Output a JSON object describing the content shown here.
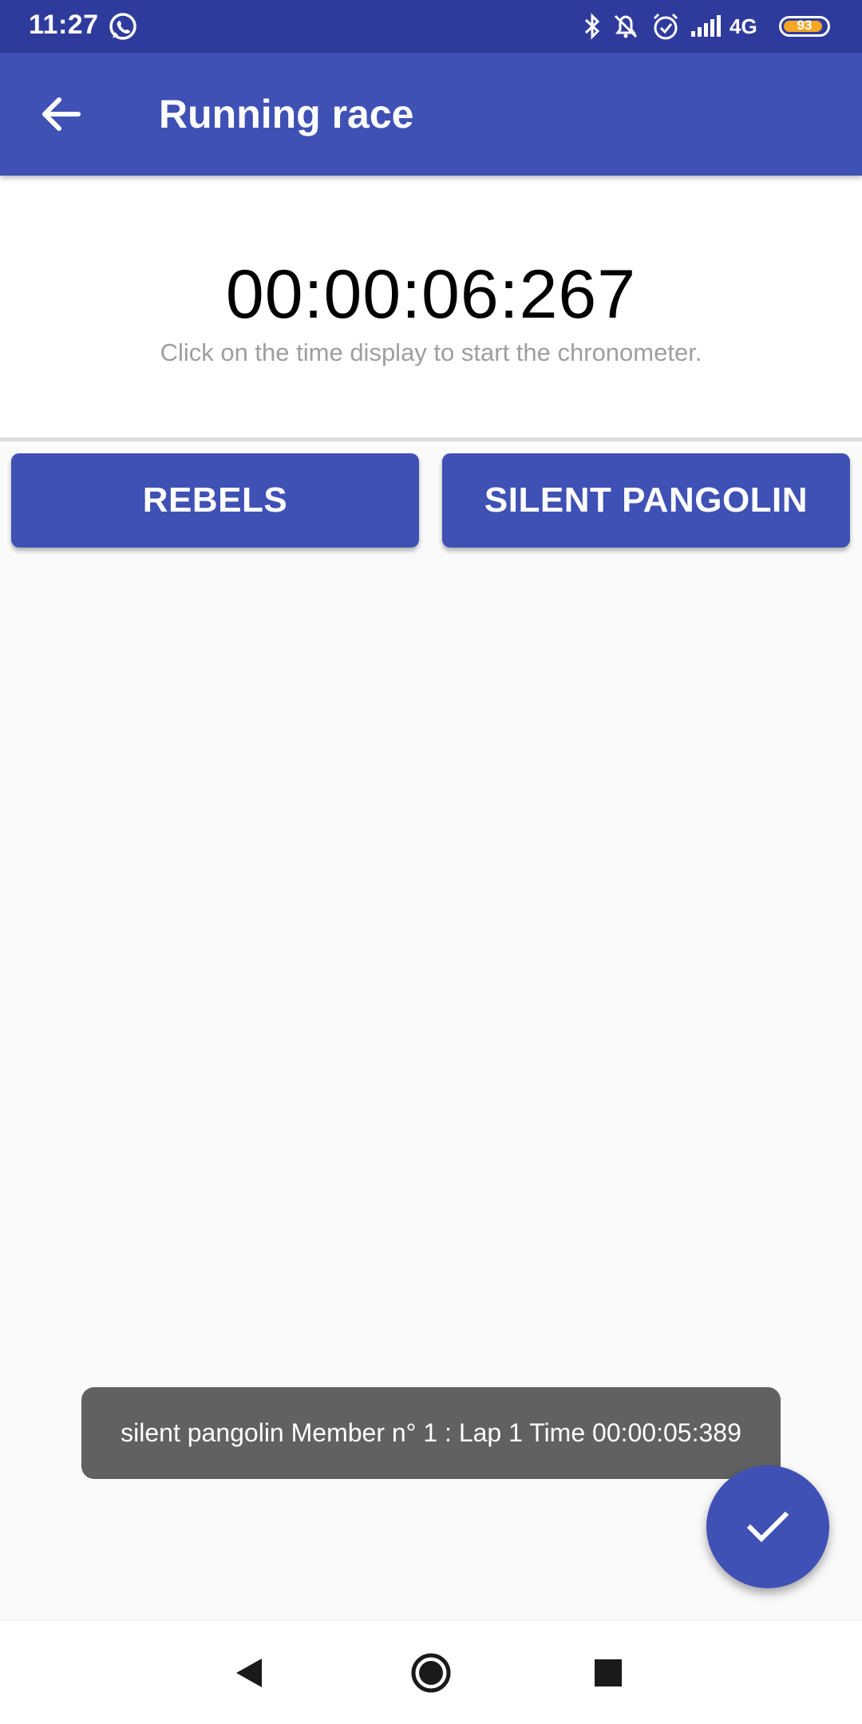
{
  "status_bar": {
    "time": "11:27",
    "network": "4G",
    "battery": "93",
    "battery_level": 0.93,
    "icons": [
      "whatsapp-icon",
      "bluetooth-icon",
      "notifications-off-icon",
      "alarm-icon",
      "signal-icon",
      "battery-icon"
    ]
  },
  "app_bar": {
    "title": "Running race",
    "back_icon": "arrow-back-icon"
  },
  "chronometer": {
    "time": "00:00:06:267",
    "hint": "Click on the time display to start the chronometer."
  },
  "teams": [
    {
      "label": "REBELS"
    },
    {
      "label": "SILENT PANGOLIN"
    }
  ],
  "toast": {
    "message": "silent pangolin Member n° 1 : Lap 1 Time 00:00:05:389"
  },
  "fab": {
    "icon": "check-icon"
  },
  "nav_bar": {
    "icons": [
      "nav-back-icon",
      "nav-home-icon",
      "nav-recents-icon"
    ]
  },
  "colors": {
    "primary": "#3f51b5",
    "primary_dark": "#2f3b9c",
    "toast_bg": "#616161",
    "hint_text": "#9e9e9e",
    "battery_accent": "#f5a623"
  }
}
